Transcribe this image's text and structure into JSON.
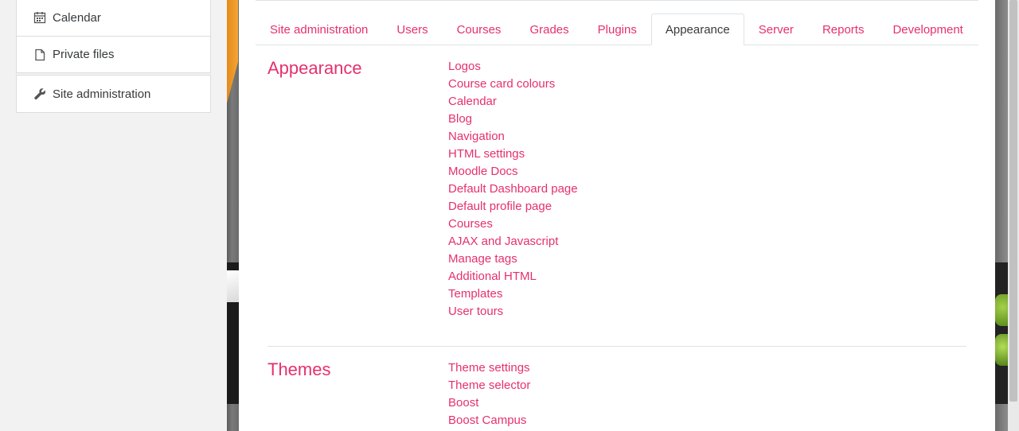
{
  "nav": {
    "top_items": [
      {
        "label": "Calendar",
        "icon": "calendar-icon"
      },
      {
        "label": "Private files",
        "icon": "file-icon"
      }
    ],
    "bottom_items": [
      {
        "label": "Site administration",
        "icon": "wrench-icon"
      }
    ]
  },
  "tabs": [
    {
      "label": "Site administration",
      "active": false
    },
    {
      "label": "Users",
      "active": false
    },
    {
      "label": "Courses",
      "active": false
    },
    {
      "label": "Grades",
      "active": false
    },
    {
      "label": "Plugins",
      "active": false
    },
    {
      "label": "Appearance",
      "active": true
    },
    {
      "label": "Server",
      "active": false
    },
    {
      "label": "Reports",
      "active": false
    },
    {
      "label": "Development",
      "active": false
    }
  ],
  "sections": [
    {
      "title": "Appearance",
      "links": [
        "Logos",
        "Course card colours",
        "Calendar",
        "Blog",
        "Navigation",
        "HTML settings",
        "Moodle Docs",
        "Default Dashboard page",
        "Default profile page",
        "Courses",
        "AJAX and Javascript",
        "Manage tags",
        "Additional HTML",
        "Templates",
        "User tours"
      ]
    },
    {
      "title": "Themes",
      "links": [
        "Theme settings",
        "Theme selector",
        "Boost",
        "Boost Campus"
      ]
    }
  ],
  "colors": {
    "accent": "#e6306d",
    "text": "#373a3c",
    "background": "#f2f2f2"
  }
}
